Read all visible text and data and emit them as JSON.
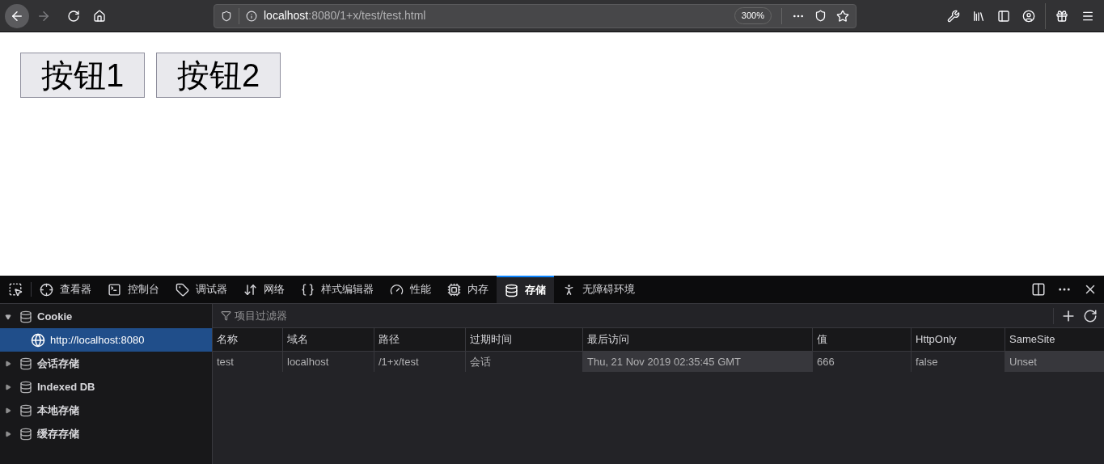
{
  "toolbar": {
    "url_host": "localhost",
    "url_rest": ":8080/1+x/test/test.html",
    "zoom": "300%"
  },
  "page": {
    "buttons": [
      "按钮1",
      "按钮2"
    ]
  },
  "devtools": {
    "tabs": [
      {
        "label": "查看器",
        "selected": false
      },
      {
        "label": "控制台",
        "selected": false
      },
      {
        "label": "调试器",
        "selected": false
      },
      {
        "label": "网络",
        "selected": false
      },
      {
        "label": "样式编辑器",
        "selected": false
      },
      {
        "label": "性能",
        "selected": false
      },
      {
        "label": "内存",
        "selected": false
      },
      {
        "label": "存储",
        "selected": true
      },
      {
        "label": "无障碍环境",
        "selected": false
      }
    ],
    "tree": [
      {
        "label": "Cookie",
        "expanded": true,
        "selected": false,
        "children": [
          {
            "label": "http://localhost:8080",
            "selected": true
          }
        ]
      },
      {
        "label": "会话存储",
        "expanded": false,
        "selected": false
      },
      {
        "label": "Indexed DB",
        "expanded": false,
        "selected": false
      },
      {
        "label": "本地存储",
        "expanded": false,
        "selected": false
      },
      {
        "label": "缓存存储",
        "expanded": false,
        "selected": false
      }
    ],
    "filter": {
      "placeholder": "项目过滤器"
    },
    "table": {
      "columns": [
        {
          "label": "名称",
          "highlighted": false
        },
        {
          "label": "域名",
          "highlighted": false
        },
        {
          "label": "路径",
          "highlighted": false
        },
        {
          "label": "过期时间",
          "highlighted": false
        },
        {
          "label": "最后访问",
          "highlighted": true
        },
        {
          "label": "值",
          "highlighted": false
        },
        {
          "label": "HttpOnly",
          "highlighted": false
        },
        {
          "label": "SameSite",
          "highlighted": true
        }
      ],
      "rows": [
        [
          "test",
          "localhost",
          "/1+x/test",
          "会话",
          "Thu, 21 Nov 2019 02:35:45 GMT",
          "666",
          "false",
          "Unset"
        ]
      ]
    }
  }
}
